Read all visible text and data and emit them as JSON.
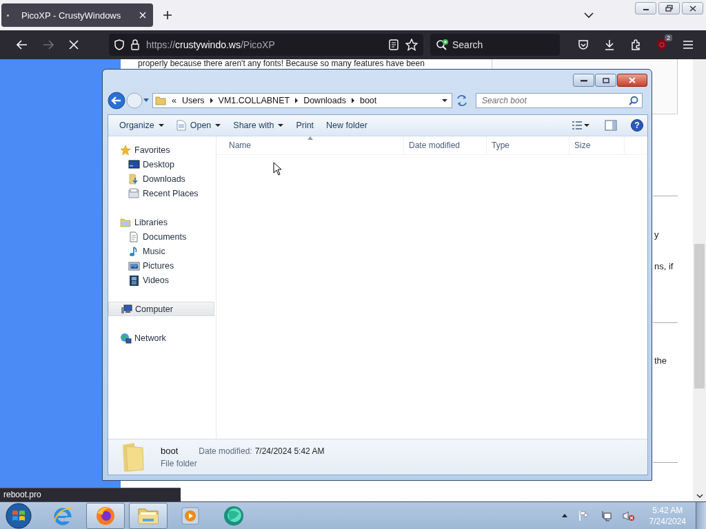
{
  "browser": {
    "tabs": [
      {
        "title": "PicoXP - CrustyWindows",
        "selected": true
      }
    ],
    "url": {
      "scheme": "https://",
      "host": "crustywindo.ws",
      "path": "/PicoXP"
    },
    "search": {
      "placeholder": "Search"
    },
    "extension_badge": "2",
    "forward_disabled": true,
    "page": {
      "line": "properly because there aren't any fonts! Because so many features have been",
      "fragments": [
        "y",
        "ns, if",
        "the"
      ]
    },
    "status_text": "reboot.pro"
  },
  "explorer": {
    "breadcrumb": [
      "Users",
      "VM1.COLLABNET",
      "Downloads",
      "boot"
    ],
    "overflow_mark": "«",
    "search": {
      "placeholder": "Search boot"
    },
    "help_mark": "?",
    "commands": [
      {
        "label": "Organize",
        "kind": "menu"
      },
      {
        "label": "Open",
        "kind": "open"
      },
      {
        "label": "Share with",
        "kind": "menu"
      },
      {
        "label": "Print",
        "kind": "plain"
      },
      {
        "label": "New folder",
        "kind": "plain"
      }
    ],
    "nav": [
      {
        "label": "Favorites",
        "kind": "star",
        "selected": false,
        "children": [
          {
            "label": "Desktop",
            "kind": "desktop",
            "selected": false
          },
          {
            "label": "Downloads",
            "kind": "downloads",
            "selected": false
          },
          {
            "label": "Recent Places",
            "kind": "recent",
            "selected": false
          }
        ]
      },
      {
        "label": "Libraries",
        "kind": "library",
        "selected": false,
        "children": [
          {
            "label": "Documents",
            "kind": "document",
            "selected": false
          },
          {
            "label": "Music",
            "kind": "music",
            "selected": false
          },
          {
            "label": "Pictures",
            "kind": "pictures",
            "selected": false
          },
          {
            "label": "Videos",
            "kind": "videos",
            "selected": false
          }
        ]
      },
      {
        "label": "Computer",
        "kind": "computer",
        "selected": true
      },
      {
        "label": "Network",
        "kind": "network",
        "selected": false
      }
    ],
    "columns": [
      {
        "label": "Name",
        "sorted": true
      },
      {
        "label": "Date modified",
        "sorted": false
      },
      {
        "label": "Type",
        "sorted": false
      },
      {
        "label": "Size",
        "sorted": false
      }
    ],
    "details": {
      "name": "boot",
      "date_label": "Date modified:",
      "date_value": "7/24/2024 5:42 AM",
      "type": "File folder"
    }
  },
  "taskbar": {
    "apps": [
      {
        "kind": "ie",
        "active": false
      },
      {
        "kind": "firefox",
        "active": true
      },
      {
        "kind": "folder",
        "active": true
      },
      {
        "kind": "media",
        "active": false
      },
      {
        "kind": "globe",
        "active": false
      }
    ],
    "clock": {
      "time": "5:42 AM",
      "date": "7/24/2024"
    }
  }
}
